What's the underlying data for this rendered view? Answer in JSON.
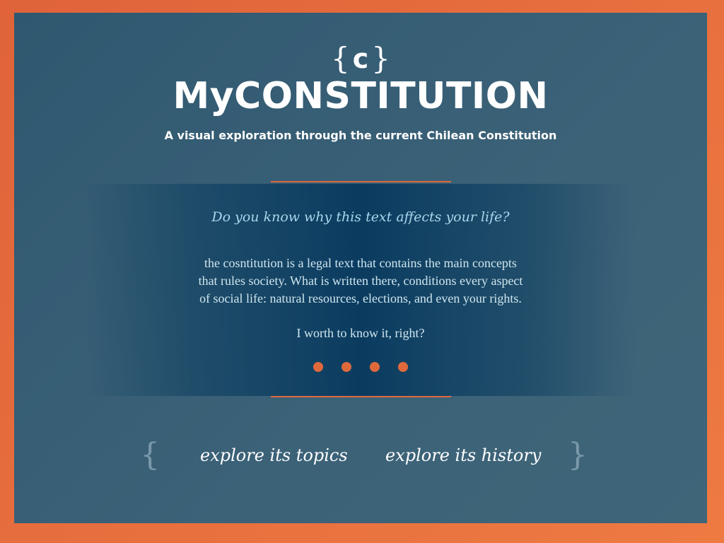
{
  "logo": {
    "open_brace": "{",
    "letter": "c",
    "close_brace": "}"
  },
  "header": {
    "title": "MyCONSTITUTION",
    "subtitle": "A visual exploration through the current Chilean Constitution"
  },
  "intro": {
    "question": "Do you know why this text affects your life?",
    "paragraph_lines": [
      "the cosntitution is a legal text that contains the main concepts",
      "that rules society. What is written there, conditions every aspect",
      "of  social life: natural resources, elections, and even your rights."
    ],
    "cta": "I worth to know it, right?"
  },
  "pager": {
    "count": 4
  },
  "nav": {
    "open_brace": "{",
    "close_brace": "}",
    "topics_label": "explore its topics",
    "history_label": "explore its history"
  },
  "colors": {
    "frame": "#e86c3e",
    "background": "#3a6076",
    "accent": "#e0693c",
    "question_text": "#a9d6ea"
  }
}
